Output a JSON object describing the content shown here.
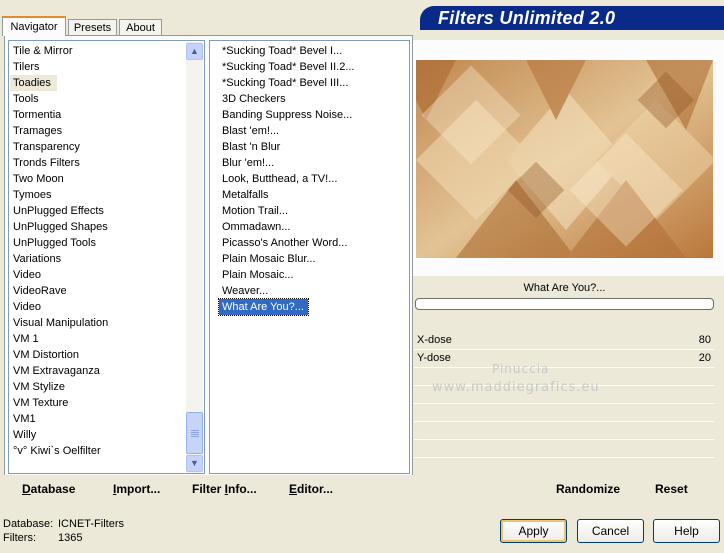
{
  "title": "Filters Unlimited 2.0",
  "tabs": [
    {
      "label": "Navigator",
      "active": true
    },
    {
      "label": "Presets",
      "active": false
    },
    {
      "label": "About",
      "active": false
    }
  ],
  "categories": [
    "Tile & Mirror",
    "Tilers",
    "Toadies",
    "Tools",
    "Tormentia",
    "Tramages",
    "Transparency",
    "Tronds Filters",
    "Two Moon",
    "Tymoes",
    "UnPlugged Effects",
    "UnPlugged Shapes",
    "UnPlugged Tools",
    "Variations",
    "Video",
    "VideoRave",
    "Video",
    "Visual Manipulation",
    "VM 1",
    "VM Distortion",
    "VM Extravaganza",
    "VM Stylize",
    "VM Texture",
    "VM1",
    "Willy",
    "°v° Kiwi`s Oelfilter"
  ],
  "selected_category_index": 2,
  "filters": [
    "*Sucking Toad*  Bevel I...",
    "*Sucking Toad*  Bevel II.2...",
    "*Sucking Toad*  Bevel III...",
    "3D Checkers",
    "Banding Suppress Noise...",
    "Blast 'em!...",
    "Blast 'n Blur",
    "Blur 'em!...",
    "Look, Butthead, a TV!...",
    "Metalfalls",
    "Motion Trail...",
    "Ommadawn...",
    "Picasso's Another Word...",
    "Plain Mosaic Blur...",
    "Plain Mosaic...",
    "Weaver...",
    "What Are You?..."
  ],
  "selected_filter_index": 16,
  "preview_caption": "What Are You?...",
  "params": [
    {
      "label": "X-dose",
      "value": "80"
    },
    {
      "label": "Y-dose",
      "value": "20"
    }
  ],
  "watermark": {
    "line1": "Pinuccia",
    "line2": "www.maddiegrafics.eu"
  },
  "bottom_links": {
    "database": {
      "u": "D",
      "rest": "atabase"
    },
    "import": {
      "u": "I",
      "rest": "mport..."
    },
    "filter_info": {
      "pre": "Filter ",
      "u": "I",
      "rest": "nfo..."
    },
    "editor": {
      "u": "E",
      "rest": "ditor..."
    },
    "randomize": "Randomize",
    "reset": "Reset"
  },
  "status": {
    "database_label": "Database:",
    "database_value": "ICNET-Filters",
    "filters_label": "Filters:",
    "filters_value": "1365"
  },
  "buttons": {
    "apply": "Apply",
    "cancel": "Cancel",
    "help": "Help"
  },
  "colors": {
    "accent": "#316ac5",
    "banner": "#0a2a8a"
  }
}
